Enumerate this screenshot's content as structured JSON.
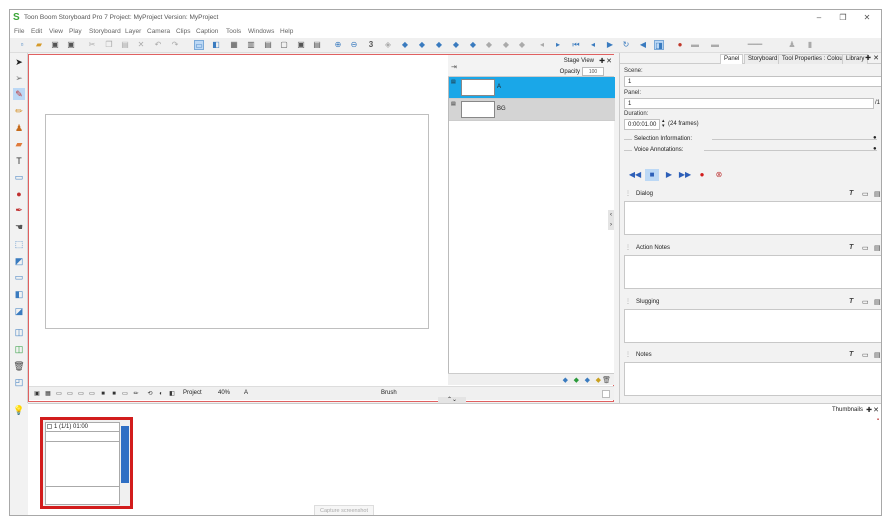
{
  "app": {
    "title": "Toon Boom Storyboard Pro 7 Project: MyProject Version: MyProject",
    "controls": [
      "–",
      "❐",
      "✕"
    ]
  },
  "menu": [
    "File",
    "Edit",
    "View",
    "Play",
    "Storyboard",
    "Layer",
    "Camera",
    "Clips",
    "Caption",
    "Tools",
    "Windows",
    "Help"
  ],
  "stage": {
    "view_label": "Stage View",
    "opacity_label": "Opacity",
    "opacity_value": "100",
    "layers": [
      {
        "name": "A",
        "selected": true
      },
      {
        "name": "BG",
        "selected": false
      }
    ],
    "bottom": {
      "project": "Project",
      "zoom": "40%",
      "layer": "A",
      "tool": "Brush"
    }
  },
  "panel": {
    "tabs": [
      "Panel",
      "Storyboard",
      "Tool Properties : Colour",
      "Library"
    ],
    "scene_label": "Scene:",
    "scene_value": "1",
    "panel_label": "Panel:",
    "panel_value": "1",
    "panel_total": "/1",
    "duration_label": "Duration:",
    "duration_value": "0:00:01.00",
    "duration_frames": "(24 frames)",
    "selection_info": "Selection Information:",
    "voice_annotations": "Voice Annotations:",
    "notes": [
      "Dialog",
      "Action Notes",
      "Slugging",
      "Notes"
    ]
  },
  "thumbnails": {
    "label": "Thumbnails",
    "card_label": "1 (1/1) 01:00",
    "capture": "Capture screenshot"
  },
  "colors": {
    "stage_border": "#e06060",
    "selected_layer": "#1aa7e8",
    "thumb_border": "#d21c1c",
    "accent": "#3a7bbf"
  }
}
